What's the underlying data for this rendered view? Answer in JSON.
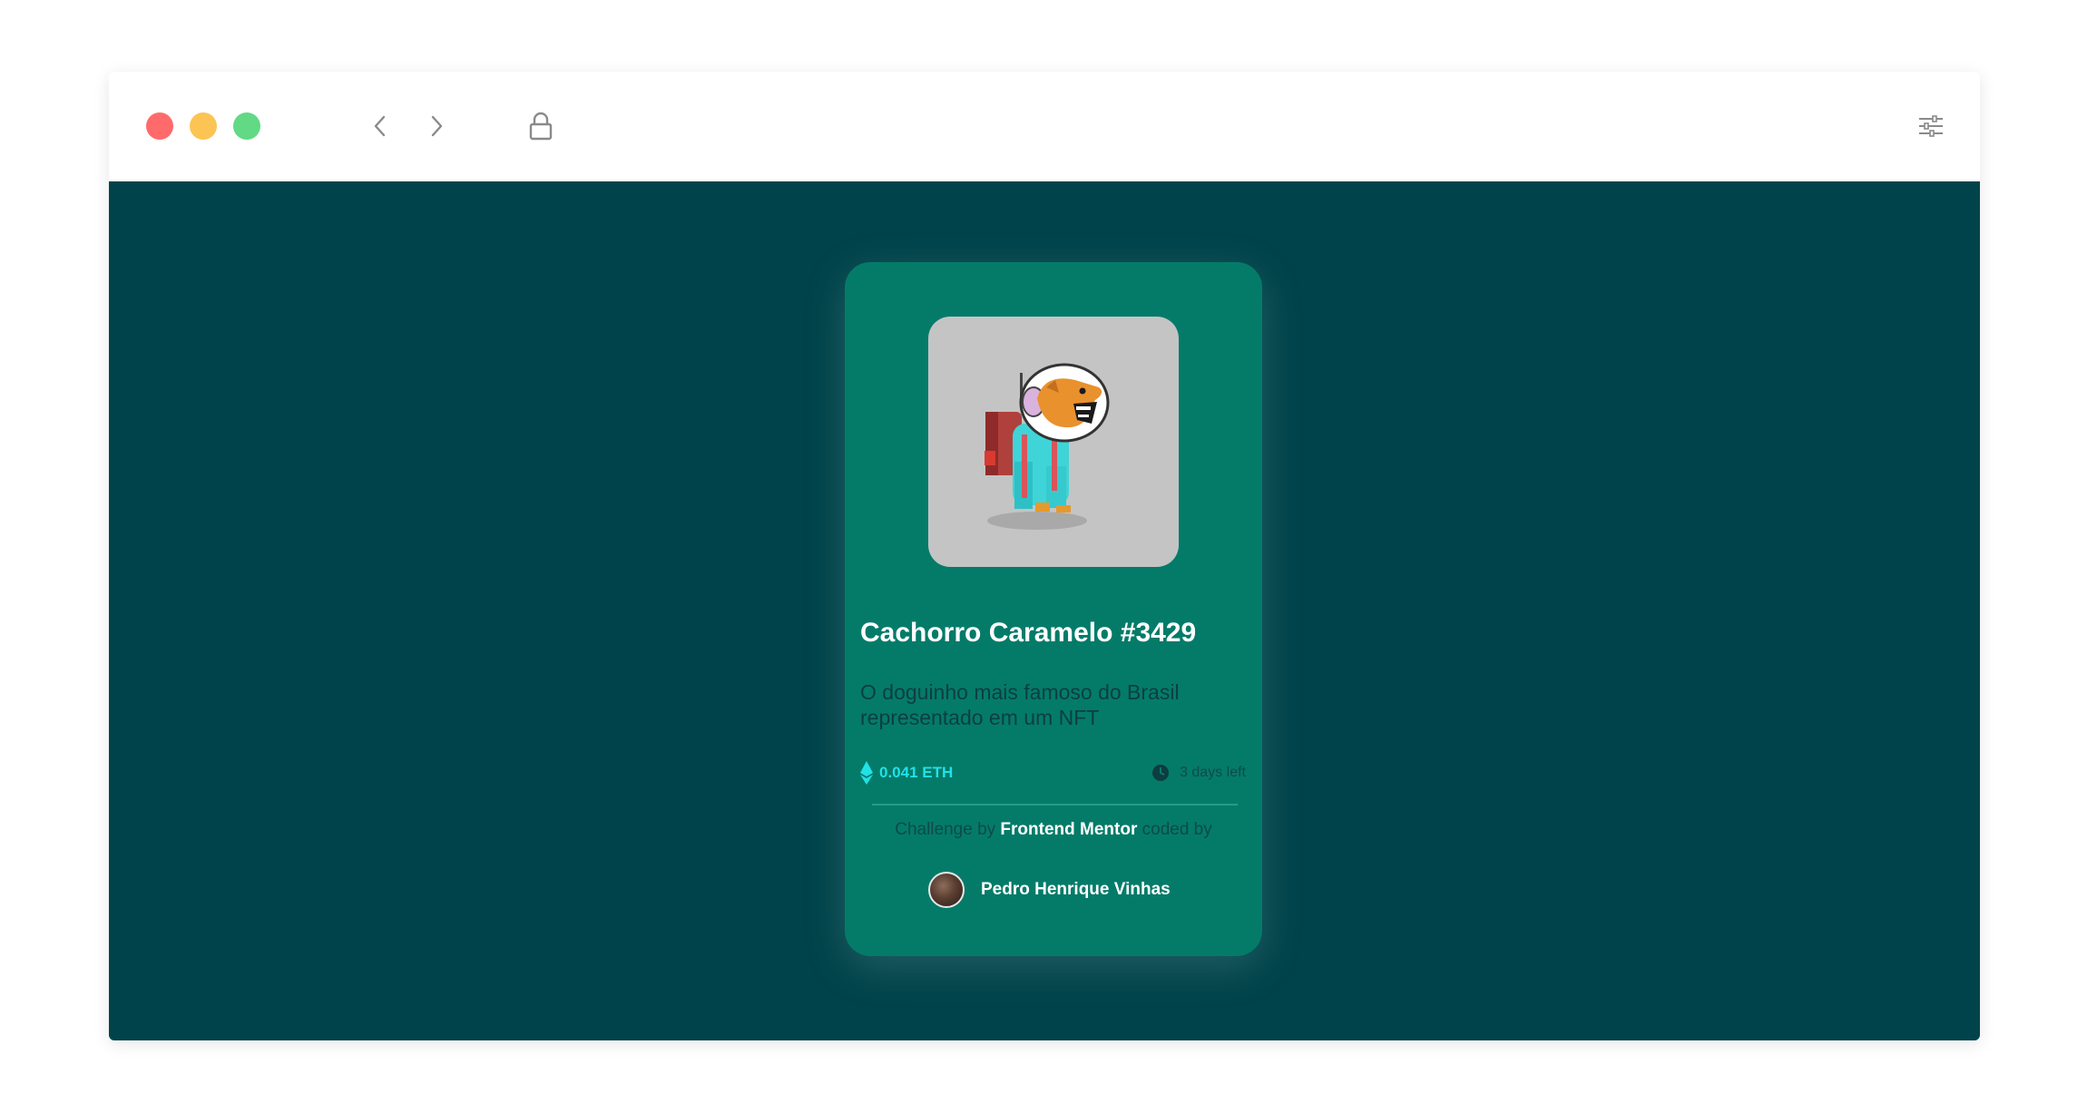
{
  "browser": {
    "traffic_lights": {
      "close_color": "#ff6b6b",
      "minimize_color": "#fcc453",
      "maximize_color": "#62d984"
    },
    "icons": {
      "back": "chevron-left-icon",
      "forward": "chevron-right-icon",
      "secure": "lock-icon",
      "settings": "sliders-icon"
    }
  },
  "page": {
    "background_color": "#01434a",
    "card_color": "#047b69",
    "accent_color": "#20e2e7"
  },
  "card": {
    "image_alt": "Pixel art dog astronaut",
    "title": "Cachorro Caramelo #3429",
    "description": "O doguinho mais famoso do Brasil representado em um NFT",
    "price": "0.041 ETH",
    "price_icon": "ethereum-icon",
    "time_left": "3 days left",
    "time_icon": "clock-icon"
  },
  "credits": {
    "prefix": "Challenge by",
    "link": "Frontend Mentor",
    "suffix": "coded by",
    "author": "Pedro Henrique Vinhas"
  }
}
